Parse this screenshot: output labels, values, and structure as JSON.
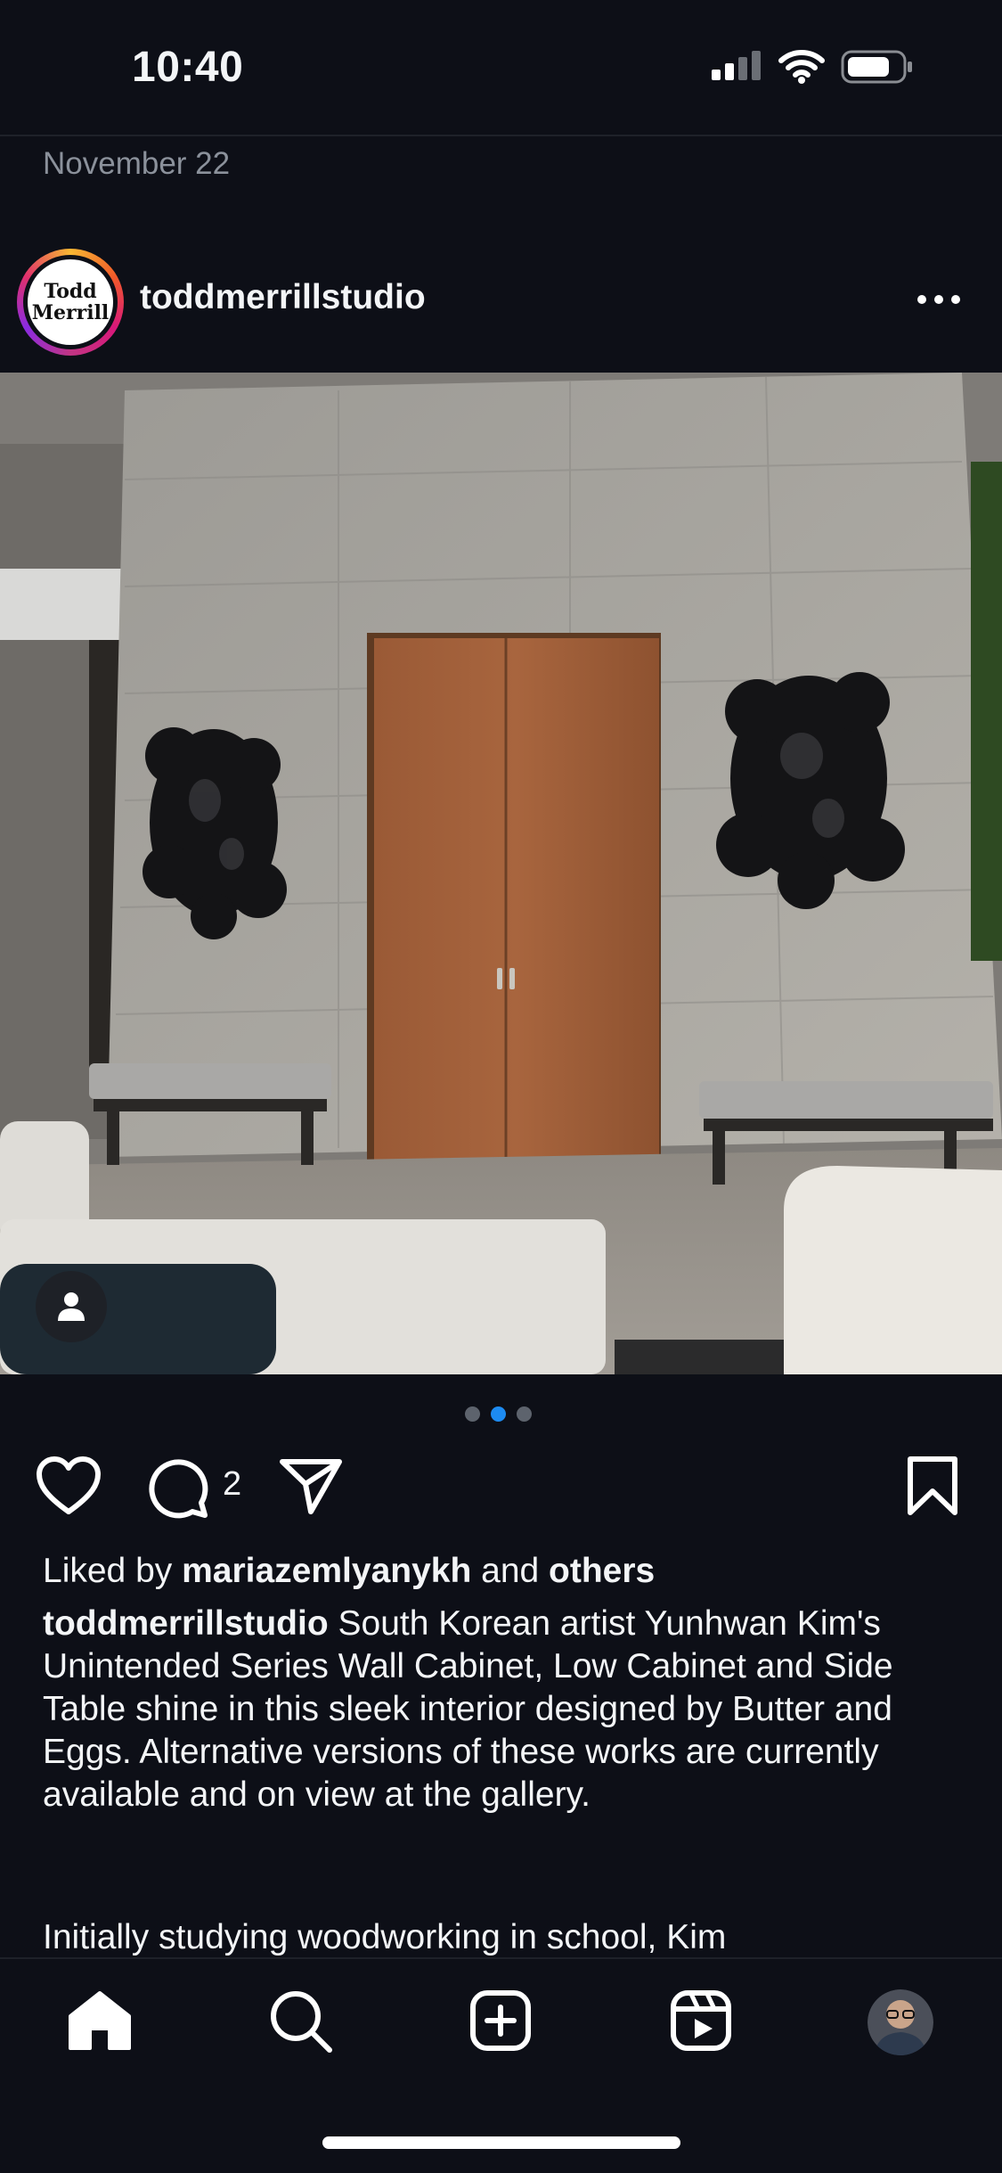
{
  "status_bar": {
    "time": "10:40",
    "signal_icon": "signal-icon",
    "wifi_icon": "wifi-icon",
    "battery_icon": "battery-icon"
  },
  "feed": {
    "date_label": "November 22"
  },
  "post": {
    "username": "toddmerrillstudio",
    "avatar_text": [
      "Todd",
      "Merrill"
    ],
    "more_icon": "more-icon",
    "carousel": {
      "count": 3,
      "active_index": 1
    },
    "user_tag_icon": "person-icon",
    "actions": {
      "like_icon": "heart-icon",
      "comment_icon": "comment-icon",
      "comment_count": "2",
      "share_icon": "send-icon",
      "save_icon": "bookmark-icon"
    },
    "likes": {
      "prefix": "Liked by ",
      "user": "mariazemlyanykh",
      "middle": " and ",
      "others": "others"
    },
    "caption": {
      "username": "toddmerrillstudio",
      "text": " South Korean artist Yunhwan Kim's Unintended Series Wall Cabinet, Low Cabinet and Side Table shine in this sleek interior designed by Butter and Eggs. Alternative versions of these works are currently available and on view at the gallery.",
      "continuation": "Initially studying woodworking in school, Kim"
    }
  },
  "tab_bar": {
    "items": [
      {
        "name": "home",
        "icon": "home-icon"
      },
      {
        "name": "search",
        "icon": "search-icon"
      },
      {
        "name": "create",
        "icon": "plus-square-icon"
      },
      {
        "name": "reels",
        "icon": "reels-icon"
      },
      {
        "name": "profile",
        "icon": "profile-avatar"
      }
    ]
  },
  "colors": {
    "background": "#0d0f17",
    "accent_dot": "#1d8bf1",
    "text": "#f3f5f7",
    "muted": "#8b919b"
  }
}
